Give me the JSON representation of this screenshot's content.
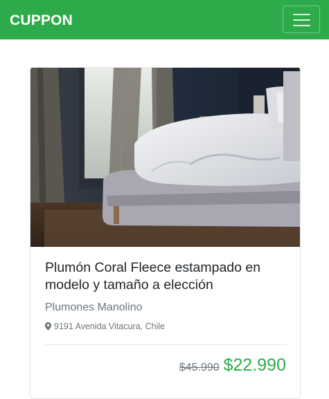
{
  "navbar": {
    "brand": "CUPPON",
    "menu_icon": "hamburger-menu-icon",
    "color": "#2dab4a"
  },
  "deal": {
    "image": "bedroom-bed-photo",
    "title": "Plumón Coral Fleece estampado en modelo y tamaño a elección",
    "merchant": "Plumones Manolino",
    "address_icon": "map-marker-icon",
    "address": "9191 Avenida Vitacura, Chile",
    "old_price": "$45.990",
    "new_price": "$22.990",
    "price_color": "#2dab4a"
  }
}
